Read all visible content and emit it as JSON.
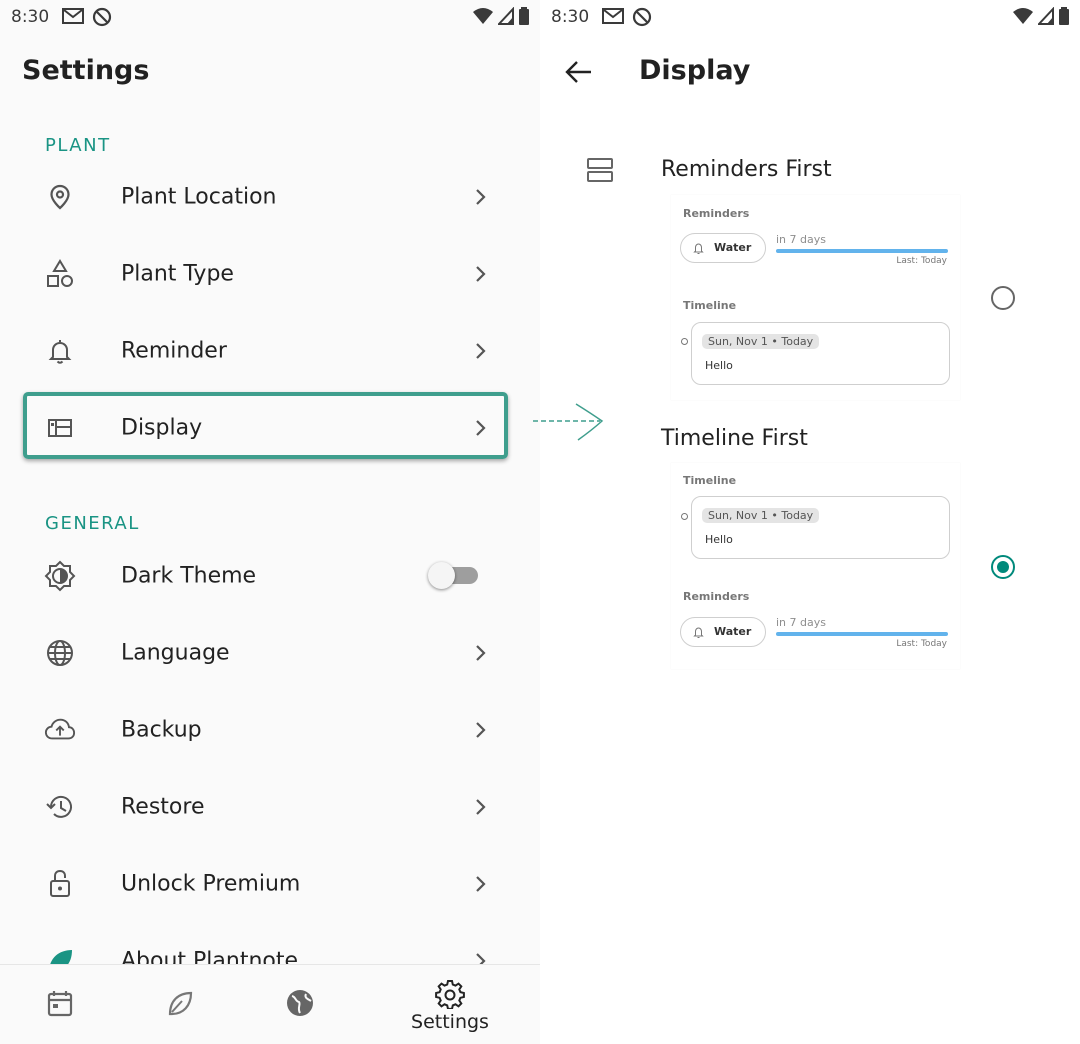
{
  "left_screen": {
    "status_bar": {
      "time": "8:30"
    },
    "title": "Settings",
    "sections": [
      {
        "label": "PLANT"
      },
      {
        "label": "GENERAL"
      }
    ],
    "items": [
      {
        "label": "Plant Location",
        "icon": "location-pin-icon"
      },
      {
        "label": "Plant Type",
        "icon": "shapes-icon"
      },
      {
        "label": "Reminder",
        "icon": "bell-icon"
      },
      {
        "label": "Display",
        "icon": "display-layout-icon"
      },
      {
        "label": "Dark Theme",
        "icon": "brightness-icon"
      },
      {
        "label": "Language",
        "icon": "globe-icon"
      },
      {
        "label": "Backup",
        "icon": "cloud-upload-icon"
      },
      {
        "label": "Restore",
        "icon": "history-icon"
      },
      {
        "label": "Unlock Premium",
        "icon": "lock-icon"
      },
      {
        "label": "About Plantnote",
        "icon": "leaf-icon"
      }
    ],
    "dark_theme_enabled": false,
    "bottom_nav": [
      {
        "label": "",
        "icon": "calendar-icon"
      },
      {
        "label": "",
        "icon": "leaf-outline-icon"
      },
      {
        "label": "",
        "icon": "globe-filled-icon"
      },
      {
        "label": "Settings",
        "icon": "gear-icon",
        "active": true
      }
    ]
  },
  "right_screen": {
    "status_bar": {
      "time": "8:30"
    },
    "title": "Display",
    "options": [
      {
        "title": "Reminders First",
        "selected": false,
        "preview": {
          "reminders_label": "Reminders",
          "chip_label": "Water",
          "due_text": "in 7 days",
          "last_text": "Last: Today",
          "timeline_label": "Timeline",
          "date_text": "Sun, Nov 1 • Today",
          "note_text": "Hello"
        }
      },
      {
        "title": "Timeline First",
        "selected": true,
        "preview": {
          "timeline_label": "Timeline",
          "date_text": "Sun, Nov 1 • Today",
          "note_text": "Hello",
          "reminders_label": "Reminders",
          "chip_label": "Water",
          "due_text": "in 7 days",
          "last_text": "Last: Today"
        }
      }
    ]
  },
  "colors": {
    "accent": "#1a9484",
    "highlight_border": "#3f9e8d",
    "progress_bar": "#62b3ec",
    "radio_selected": "#00897b"
  }
}
